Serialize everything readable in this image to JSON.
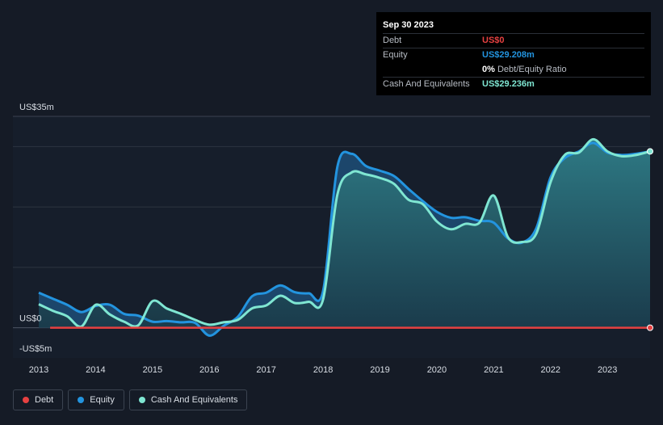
{
  "tooltip": {
    "date": "Sep 30 2023",
    "rows": [
      {
        "label": "Debt",
        "value": "US$0",
        "color": "#e64141"
      },
      {
        "label": "Equity",
        "value": "US$29.208m",
        "color": "#2394df"
      },
      {
        "label": "",
        "value": "0%",
        "sub": "Debt/Equity Ratio",
        "color": "#ffffff"
      },
      {
        "label": "Cash And Equivalents",
        "value": "US$29.236m",
        "color": "#7fe6d2"
      }
    ]
  },
  "chart_data": {
    "type": "area",
    "ylim": [
      -5,
      35
    ],
    "y_tick_labels": [
      {
        "value": 35,
        "label": "US$35m"
      },
      {
        "value": 0,
        "label": "US$0"
      },
      {
        "value": -5,
        "label": "-US$5m"
      }
    ],
    "x_ticks": [
      "2013",
      "2014",
      "2015",
      "2016",
      "2017",
      "2018",
      "2019",
      "2020",
      "2021",
      "2022",
      "2023"
    ],
    "xlim": [
      2013.0,
      2023.75
    ],
    "series": [
      {
        "name": "Debt",
        "color": "#e64141",
        "x": [
          2013.0,
          2023.75
        ],
        "y": [
          0,
          0
        ]
      },
      {
        "name": "Equity",
        "color": "#2394df",
        "x": [
          2013.0,
          2013.25,
          2013.5,
          2013.75,
          2014.0,
          2014.25,
          2014.5,
          2014.75,
          2015.0,
          2015.25,
          2015.5,
          2015.75,
          2016.0,
          2016.25,
          2016.5,
          2016.75,
          2017.0,
          2017.25,
          2017.5,
          2017.75,
          2018.0,
          2018.25,
          2018.5,
          2018.75,
          2019.0,
          2019.25,
          2019.5,
          2019.75,
          2020.0,
          2020.25,
          2020.5,
          2020.75,
          2021.0,
          2021.25,
          2021.5,
          2021.75,
          2022.0,
          2022.25,
          2022.5,
          2022.75,
          2023.0,
          2023.25,
          2023.5,
          2023.75
        ],
        "y": [
          5.8,
          4.8,
          3.8,
          2.6,
          3.6,
          3.8,
          2.3,
          2.0,
          1.0,
          1.1,
          0.9,
          0.8,
          -1.3,
          0.3,
          1.8,
          5.2,
          5.8,
          7.0,
          5.9,
          5.7,
          6.1,
          26.6,
          28.8,
          26.8,
          26.0,
          25.1,
          23.0,
          21.0,
          19.2,
          18.2,
          18.3,
          17.7,
          17.4,
          14.8,
          14.1,
          16.5,
          24.9,
          28.1,
          29.2,
          30.6,
          29.0,
          28.6,
          28.8,
          29.2
        ]
      },
      {
        "name": "Cash And Equivalents",
        "color": "#7fe6d2",
        "x": [
          2013.0,
          2013.25,
          2013.5,
          2013.75,
          2014.0,
          2014.25,
          2014.5,
          2014.75,
          2015.0,
          2015.25,
          2015.5,
          2015.75,
          2016.0,
          2016.25,
          2016.5,
          2016.75,
          2017.0,
          2017.25,
          2017.5,
          2017.75,
          2018.0,
          2018.25,
          2018.5,
          2018.75,
          2019.0,
          2019.25,
          2019.5,
          2019.75,
          2020.0,
          2020.25,
          2020.5,
          2020.75,
          2021.0,
          2021.25,
          2021.5,
          2021.75,
          2022.0,
          2022.25,
          2022.5,
          2022.75,
          2023.0,
          2023.25,
          2023.5,
          2023.75
        ],
        "y": [
          3.9,
          2.8,
          1.9,
          0.2,
          3.8,
          2.2,
          1.0,
          0.4,
          4.4,
          3.2,
          2.3,
          1.3,
          0.5,
          0.9,
          1.3,
          3.2,
          3.7,
          5.3,
          4.1,
          4.3,
          4.7,
          22.0,
          25.7,
          25.4,
          24.8,
          23.8,
          21.2,
          20.5,
          17.6,
          16.3,
          17.2,
          17.4,
          21.9,
          15.0,
          14.2,
          15.6,
          24.1,
          28.6,
          29.0,
          31.2,
          29.2,
          28.4,
          28.6,
          29.2
        ]
      }
    ],
    "grid": true,
    "legend_position": "bottom-left"
  },
  "legend": [
    {
      "label": "Debt",
      "color": "#e64141"
    },
    {
      "label": "Equity",
      "color": "#2394df"
    },
    {
      "label": "Cash And Equivalents",
      "color": "#7fe6d2"
    }
  ]
}
